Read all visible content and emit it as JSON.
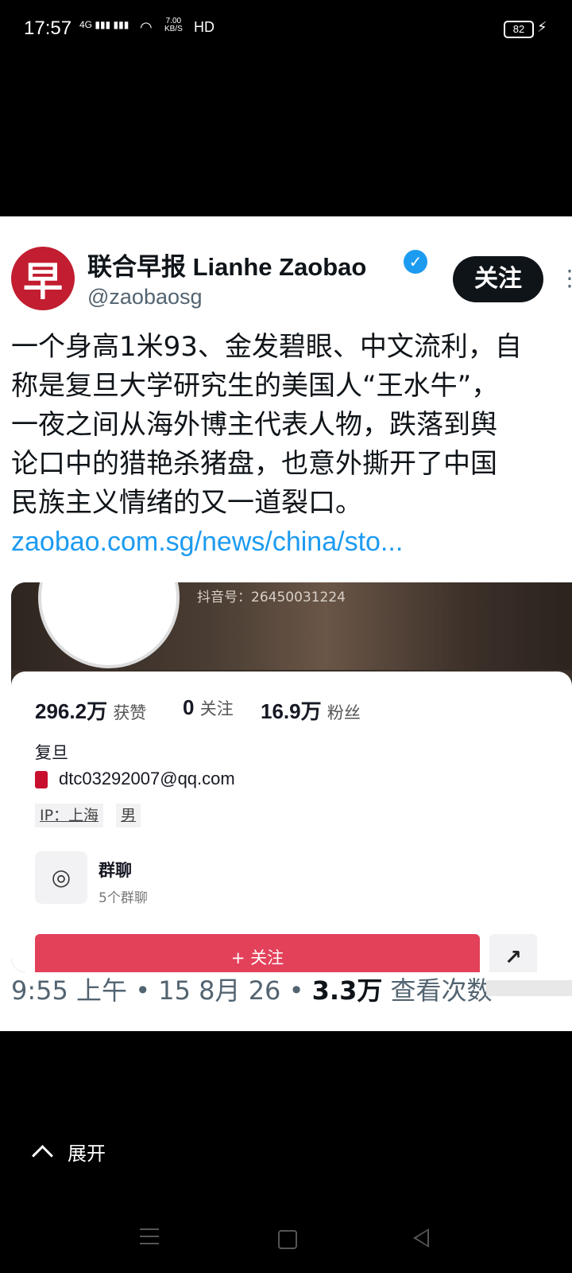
{
  "status_bar": {
    "time": "17:57",
    "signal": "4G",
    "rate_value": "7.00",
    "rate_unit": "KB/S",
    "hd": "HD",
    "battery": "82"
  },
  "post": {
    "author_name": "联合早报 Lianhe Zaobao",
    "avatar_glyph": "早",
    "handle": "@zaobaosg",
    "follow_label": "关注",
    "text_lines": [
      "一个身高1米93、金发碧眼、中文流利，自",
      "称是复旦大学研究生的美国人“王水牛”，",
      "一夜之间从海外博主代表人物，跌落到舆",
      "论口中的猎艳杀猪盘，也意外撕开了中国",
      "民族主义情绪的又一道裂口。"
    ],
    "link": "zaobao.com.sg/news/china/sto...",
    "time": "9:55 上午",
    "date": "15 8月 26",
    "views": "3.3万",
    "views_label": "查看次数"
  },
  "media": {
    "douyin_id": "抖音号：26450031224",
    "stats": [
      {
        "value": "296.2万",
        "label": "获赞"
      },
      {
        "value": "0",
        "label": "关注"
      },
      {
        "value": "16.9万",
        "label": "粉丝"
      }
    ],
    "school": "复旦",
    "email": "dtc03292007@qq.com",
    "tags": [
      "IP：上海",
      "男"
    ],
    "group_title": "群聊",
    "group_sub": "5个群聊",
    "follow_button": "+ 关注"
  },
  "bottom": {
    "expand_label": "展开"
  }
}
